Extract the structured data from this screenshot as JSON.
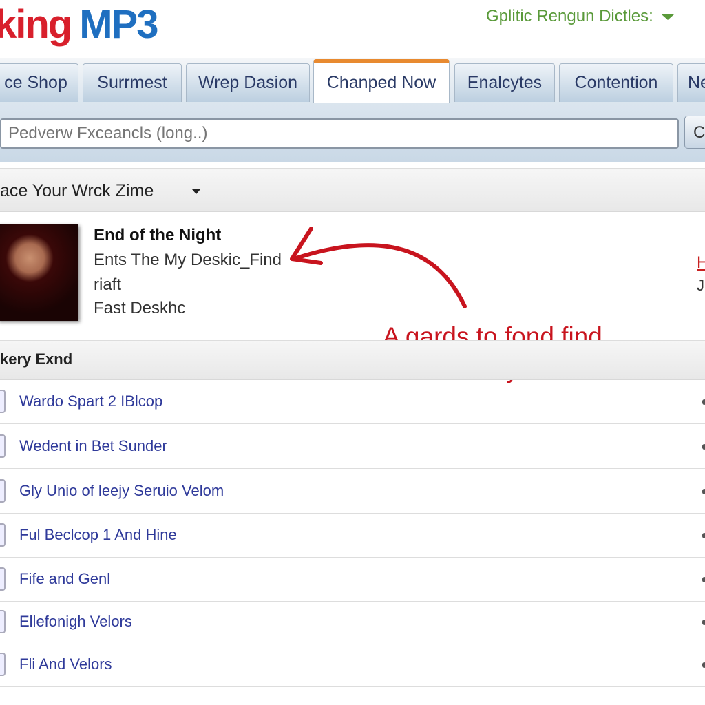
{
  "header": {
    "logo_part1": "king",
    "logo_part2": "MP3",
    "language_label": "Gplitic Rengun Dictles:"
  },
  "tabs": [
    {
      "label": "ce Shop"
    },
    {
      "label": "Surrmest"
    },
    {
      "label": "Wrep Dasion"
    },
    {
      "label": "Chanped Now",
      "active": true
    },
    {
      "label": "Enalcytes"
    },
    {
      "label": "Contention"
    },
    {
      "label": "Ne"
    }
  ],
  "search": {
    "placeholder": "Pedverw Fxceancls (long..)",
    "button_label": "C"
  },
  "section1": {
    "title": "ace Your Wrck Zime"
  },
  "featured": {
    "title": "End of the Night",
    "line1": "Ents The My Deskic_Find",
    "line2": "riaft",
    "line3": "Fast Deskhc",
    "right_link": "H",
    "right_text": "J"
  },
  "annotation": {
    "line1": "A gards to fond find",
    "line2": "to have why find riub!",
    "color": "#c8141e"
  },
  "section2": {
    "title": "kery Exnd"
  },
  "list": [
    "Wardo Spart 2 IBlcop",
    "Wedent in Bet Sunder",
    "Gly Unio of leejy Seruio Velom",
    "Ful Beclcop 1 And Hine",
    "Fife and Genl",
    "Ellefonigh Velors",
    "Fli And Velors"
  ]
}
